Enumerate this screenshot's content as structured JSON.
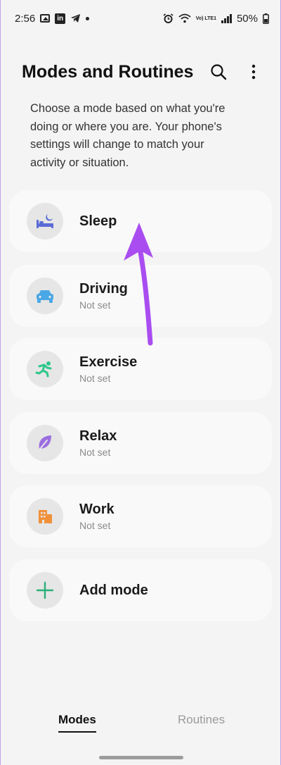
{
  "status_bar": {
    "time": "2:56",
    "battery": "50%",
    "network": "Vo) LTE1"
  },
  "header": {
    "title": "Modes and Routines"
  },
  "description": "Choose a mode based on what you're doing or where you are. Your phone's settings will change to match your activity or situation.",
  "modes": [
    {
      "name": "Sleep",
      "status": "",
      "icon": "bed-icon",
      "color": "#5b6bd6"
    },
    {
      "name": "Driving",
      "status": "Not set",
      "icon": "car-icon",
      "color": "#4aa7e6"
    },
    {
      "name": "Exercise",
      "status": "Not set",
      "icon": "running-icon",
      "color": "#2ec68a"
    },
    {
      "name": "Relax",
      "status": "Not set",
      "icon": "leaf-icon",
      "color": "#9b6ee0"
    },
    {
      "name": "Work",
      "status": "Not set",
      "icon": "building-icon",
      "color": "#f0913a"
    },
    {
      "name": "Add mode",
      "status": "",
      "icon": "plus-icon",
      "color": "#2bb07a"
    }
  ],
  "tabs": {
    "modes": "Modes",
    "routines": "Routines"
  },
  "colors": {
    "annotation_arrow": "#a94df0",
    "frame_border": "#b9a4e8"
  }
}
